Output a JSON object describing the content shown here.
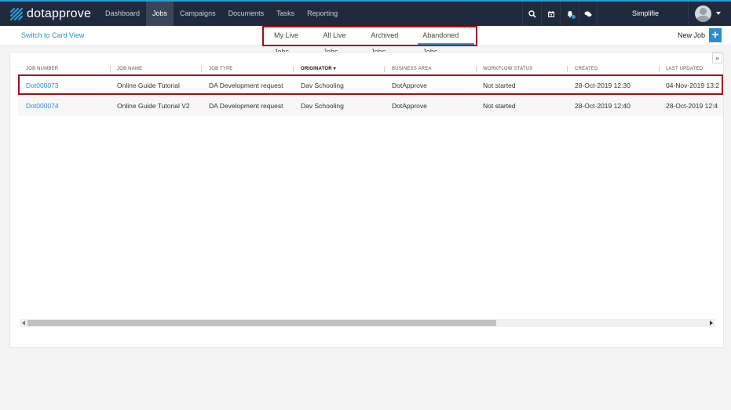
{
  "app": {
    "logo_text": "dotapprove",
    "user_name": "Simplifie"
  },
  "nav": {
    "items": [
      "Dashboard",
      "Jobs",
      "Campaigns",
      "Documents",
      "Tasks",
      "Reporting"
    ],
    "active": "Jobs"
  },
  "icons": {
    "search": "search-icon",
    "calendar": "calendar-icon",
    "bell": "bell-icon",
    "chat": "chat-icon"
  },
  "subbar": {
    "switch_view": "Switch to Card View",
    "tabs": [
      "My Live Jobs",
      "All Live Jobs",
      "Archived Jobs",
      "Abandoned Jobs"
    ],
    "active_tab": "Abandoned Jobs",
    "new_job_label": "New Job",
    "new_job_icon": "+"
  },
  "table": {
    "expand": "»",
    "columns": [
      "JOB NUMBER",
      "JOB NAME",
      "JOB TYPE",
      "ORIGINATOR",
      "BUSINESS AREA",
      "WORKFLOW STATUS",
      "CREATED",
      "LAST UPDATED"
    ],
    "sorted_column": "ORIGINATOR",
    "filter_icon": "▾",
    "rows": [
      [
        "Dot000073",
        "Online Guide Tutorial",
        "DA Development request",
        "Dav Schooling",
        "DotApprove",
        "Not started",
        "28-Oct-2019 12:30",
        "04-Nov-2019 13:2"
      ],
      [
        "Dot000074",
        "Online Guide Tutorial V2",
        "DA Development request",
        "Dav Schooling",
        "DotApprove",
        "Not started",
        "28-Oct-2019 12:40",
        "28-Oct-2019 12:4"
      ]
    ]
  },
  "colors": {
    "accent": "#2b9bd8",
    "nav_bg": "#1f2a3c",
    "highlight": "#a80d12",
    "link": "#2b8fcf"
  }
}
